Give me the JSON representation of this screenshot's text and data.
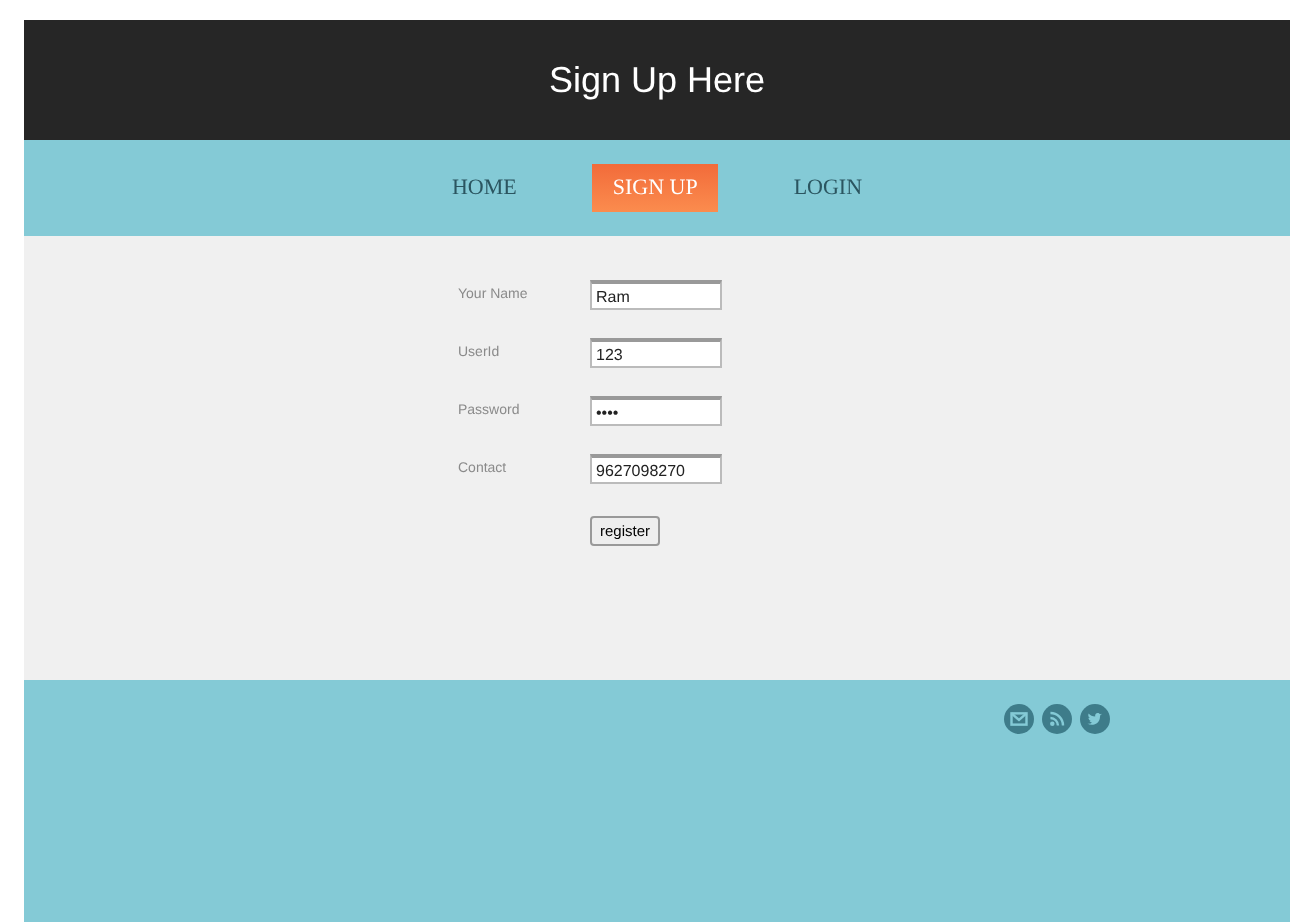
{
  "header": {
    "title": "Sign Up Here"
  },
  "nav": [
    {
      "label": "HOME",
      "selected": false
    },
    {
      "label": "SIGN UP",
      "selected": true
    },
    {
      "label": "LOGIN",
      "selected": false
    }
  ],
  "form": {
    "fields": [
      {
        "label": "Your Name",
        "value": "Ram"
      },
      {
        "label": "UserId",
        "value": "123"
      },
      {
        "label": "Password",
        "value": "••••"
      },
      {
        "label": "Contact",
        "value": "9627098270"
      }
    ],
    "submit": "register"
  },
  "footer": {
    "social": [
      {
        "kind": "mail"
      },
      {
        "kind": "rss"
      },
      {
        "kind": "twitter"
      }
    ]
  }
}
